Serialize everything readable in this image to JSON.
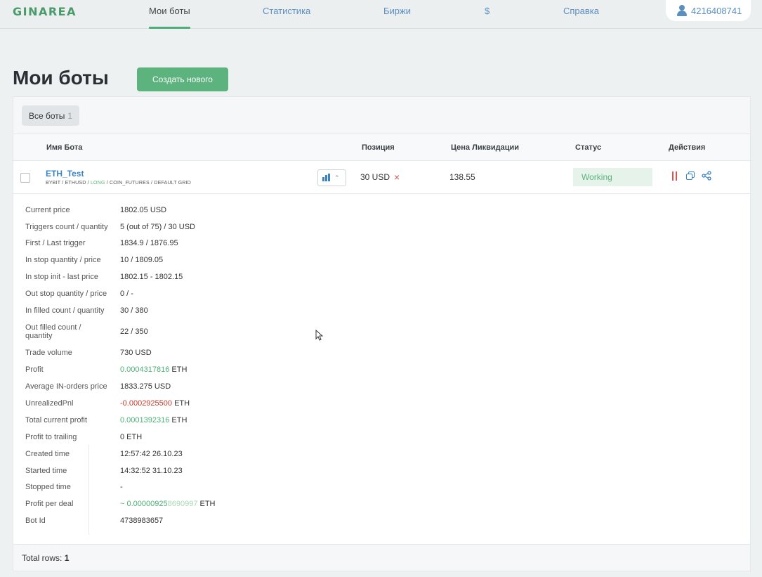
{
  "nav": {
    "logo": "GINAREA",
    "items": [
      "Мои боты",
      "Статистика",
      "Биржи",
      "$",
      "Справка"
    ],
    "user_id": "4216408741"
  },
  "page": {
    "title": "Мои боты",
    "create_label": "Создать нового"
  },
  "filter": {
    "label": "Все боты",
    "count": "1"
  },
  "table": {
    "columns": [
      "Имя Бота",
      "Позиция",
      "Цена Ликвидации",
      "Статус",
      "Действия"
    ]
  },
  "bot": {
    "name": "ETH_Test",
    "exchange": "BYBIT",
    "pair": "ETHUSD",
    "side": "LONG",
    "market": "COIN_FUTURES",
    "strategy": "DEFAULT GRID",
    "position": "30 USD",
    "liquidation_price": "138.55",
    "status": "Working"
  },
  "details": [
    {
      "label": "Current price",
      "value": "1802.05 USD"
    },
    {
      "label": "Triggers count / quantity",
      "value": "5 (out of 75) / 30 USD"
    },
    {
      "label": "First / Last trigger",
      "value": "1834.9 / 1876.95"
    },
    {
      "label": "In stop quantity / price",
      "value": "10 / 1809.05"
    },
    {
      "label": "In stop init - last price",
      "value": "1802.15 - 1802.15"
    },
    {
      "label": "Out stop quantity / price",
      "value": "0 / -"
    },
    {
      "label": "In filled count / quantity",
      "value": "30 / 380"
    },
    {
      "label": "Out filled count / quantity",
      "value": "22 / 350"
    },
    {
      "label": "Trade volume",
      "value": "730 USD"
    },
    {
      "label": "Profit",
      "value": "0.0004317816",
      "unit": "ETH",
      "tone": "green"
    },
    {
      "label": "Average IN-orders price",
      "value": "1833.275 USD"
    },
    {
      "label": "UnrealizedPnl",
      "value": "-0.0002925500",
      "unit": "ETH",
      "tone": "red"
    },
    {
      "label": "Total current profit",
      "value": "0.0001392316",
      "unit": "ETH",
      "tone": "green"
    },
    {
      "label": "Profit to trailing",
      "value": "0 ETH"
    },
    {
      "label": "Created time",
      "value": "12:57:42 26.10.23"
    },
    {
      "label": "Started time",
      "value": "14:32:52 31.10.23"
    },
    {
      "label": "Stopped time",
      "value": "-"
    },
    {
      "label": "Profit per deal",
      "value": "~ 0.00000925",
      "value_extra": "8690997",
      "unit": "ETH",
      "tone": "green"
    },
    {
      "label": "Bot Id",
      "value": "4738983657"
    }
  ],
  "footer": {
    "label": "Total rows:",
    "count": "1"
  },
  "colors": {
    "accent_green": "#5cb37d",
    "link_blue": "#3b84c4",
    "danger_red": "#d9534f"
  }
}
